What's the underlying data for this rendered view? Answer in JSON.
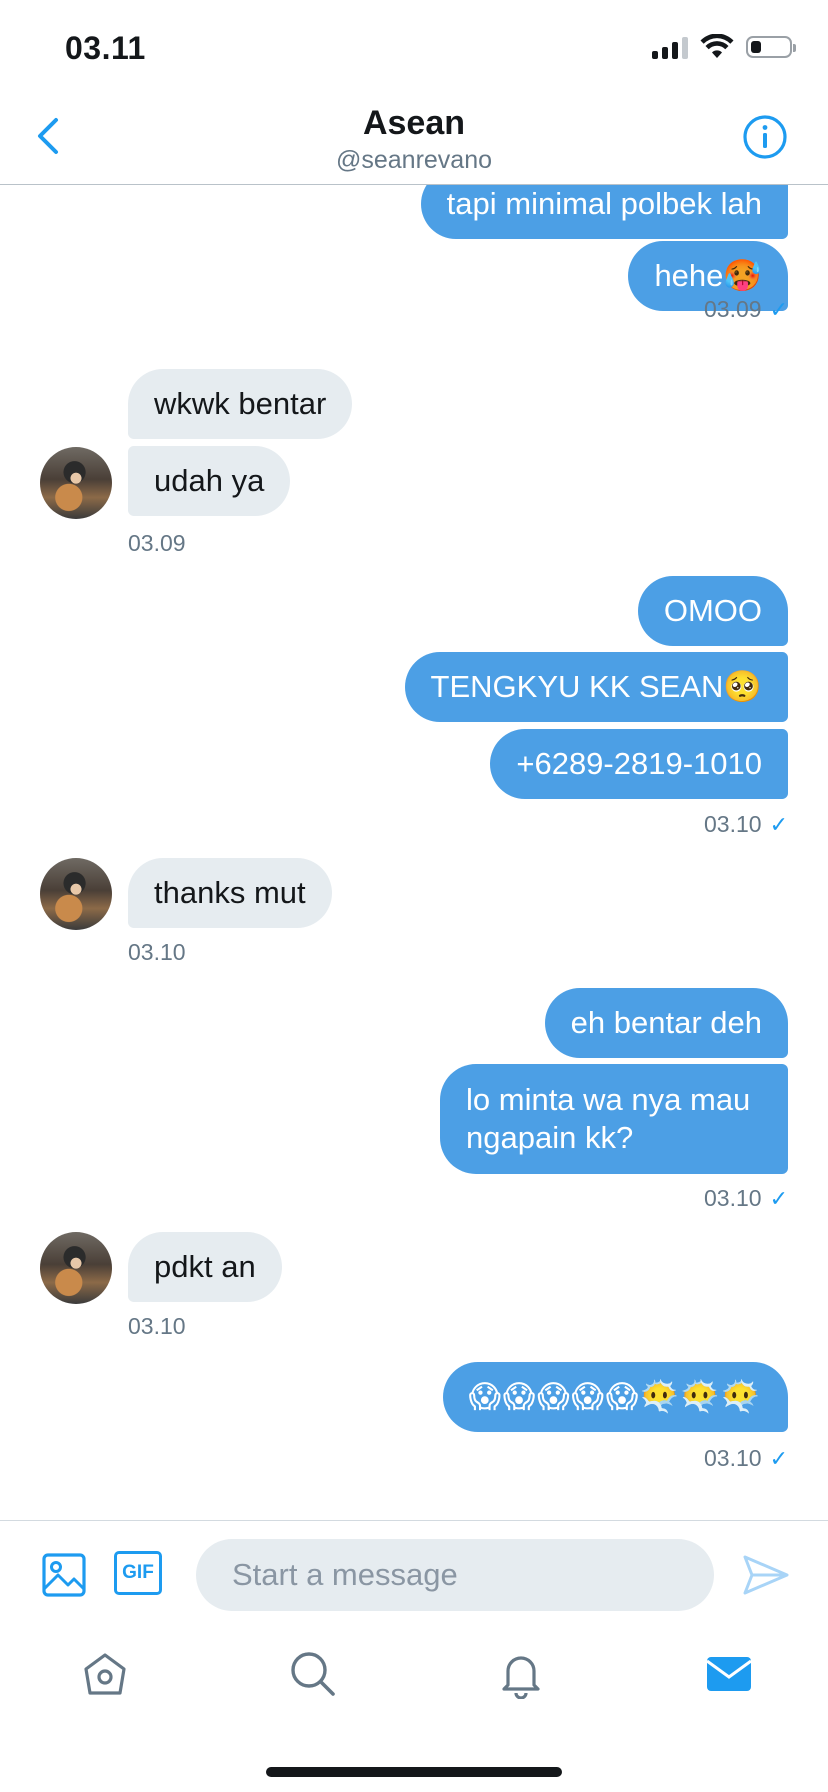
{
  "status_bar": {
    "time": "03.11",
    "icons": [
      "signal-icon",
      "wifi-icon",
      "battery-icon"
    ]
  },
  "header": {
    "title": "Asean",
    "handle": "@seanrevano",
    "icons": {
      "back": "chevron-left-icon",
      "info": "info-icon"
    }
  },
  "messages": [
    {
      "dir": "out",
      "text": "tapi minimal polbek lah"
    },
    {
      "dir": "out",
      "text": "hehe🥵"
    },
    {
      "timestamp": "03.09",
      "dir": "out"
    },
    {
      "dir": "in",
      "text": "wkwk bentar"
    },
    {
      "dir": "in",
      "text": "udah ya"
    },
    {
      "timestamp": "03.09",
      "dir": "in"
    },
    {
      "dir": "out",
      "text": "OMOO"
    },
    {
      "dir": "out",
      "text": "TENGKYU KK SEAN🥺"
    },
    {
      "dir": "out",
      "text": "+6289-2819-1010"
    },
    {
      "timestamp": "03.10",
      "dir": "out"
    },
    {
      "dir": "in",
      "text": "thanks mut"
    },
    {
      "timestamp": "03.10",
      "dir": "in"
    },
    {
      "dir": "out",
      "text": "eh bentar deh"
    },
    {
      "dir": "out",
      "text": "lo minta wa nya mau ngapain kk?"
    },
    {
      "timestamp": "03.10",
      "dir": "out"
    },
    {
      "dir": "in",
      "text": "pdkt an"
    },
    {
      "timestamp": "03.10",
      "dir": "in"
    },
    {
      "dir": "out",
      "text": "😱😱😱😱😱😶‍🌫️😶‍🌫️😶‍🌫️"
    },
    {
      "timestamp": "03.10",
      "dir": "out"
    }
  ],
  "bubbles": {
    "m1": "tapi minimal polbek lah",
    "m2": "hehe🥵",
    "m3": "wkwk bentar",
    "m4": "udah ya",
    "m5": "OMOO",
    "m6": "TENGKYU KK SEAN🥺",
    "m7": "+6289-2819-1010",
    "m8": "thanks mut",
    "m9": "eh bentar deh",
    "m10_line1": "lo minta wa nya mau",
    "m10_line2": "ngapain kk?",
    "m11": "pdkt an",
    "m12": "😱😱😱😱😱😶‍🌫️😶‍🌫️😶‍🌫️"
  },
  "timestamps": {
    "t1": "03.09",
    "t2": "03.09",
    "t3": "03.10",
    "t4": "03.10",
    "t5": "03.10",
    "t6": "03.10",
    "t7": "03.10"
  },
  "read_mark": "✓",
  "composer": {
    "placeholder": "Start a message",
    "value": "",
    "icons": [
      "image-icon",
      "gif-icon",
      "send-icon"
    ],
    "gif_label": "GIF"
  },
  "bottom_nav": {
    "items": [
      "home-icon",
      "search-icon",
      "notifications-icon",
      "messages-icon"
    ],
    "active": "messages-icon"
  },
  "colors": {
    "outgoing_bubble": "#4c9fe5",
    "incoming_bubble": "#e6ecf0",
    "accent": "#1d9bf0",
    "muted_text": "#657786"
  }
}
